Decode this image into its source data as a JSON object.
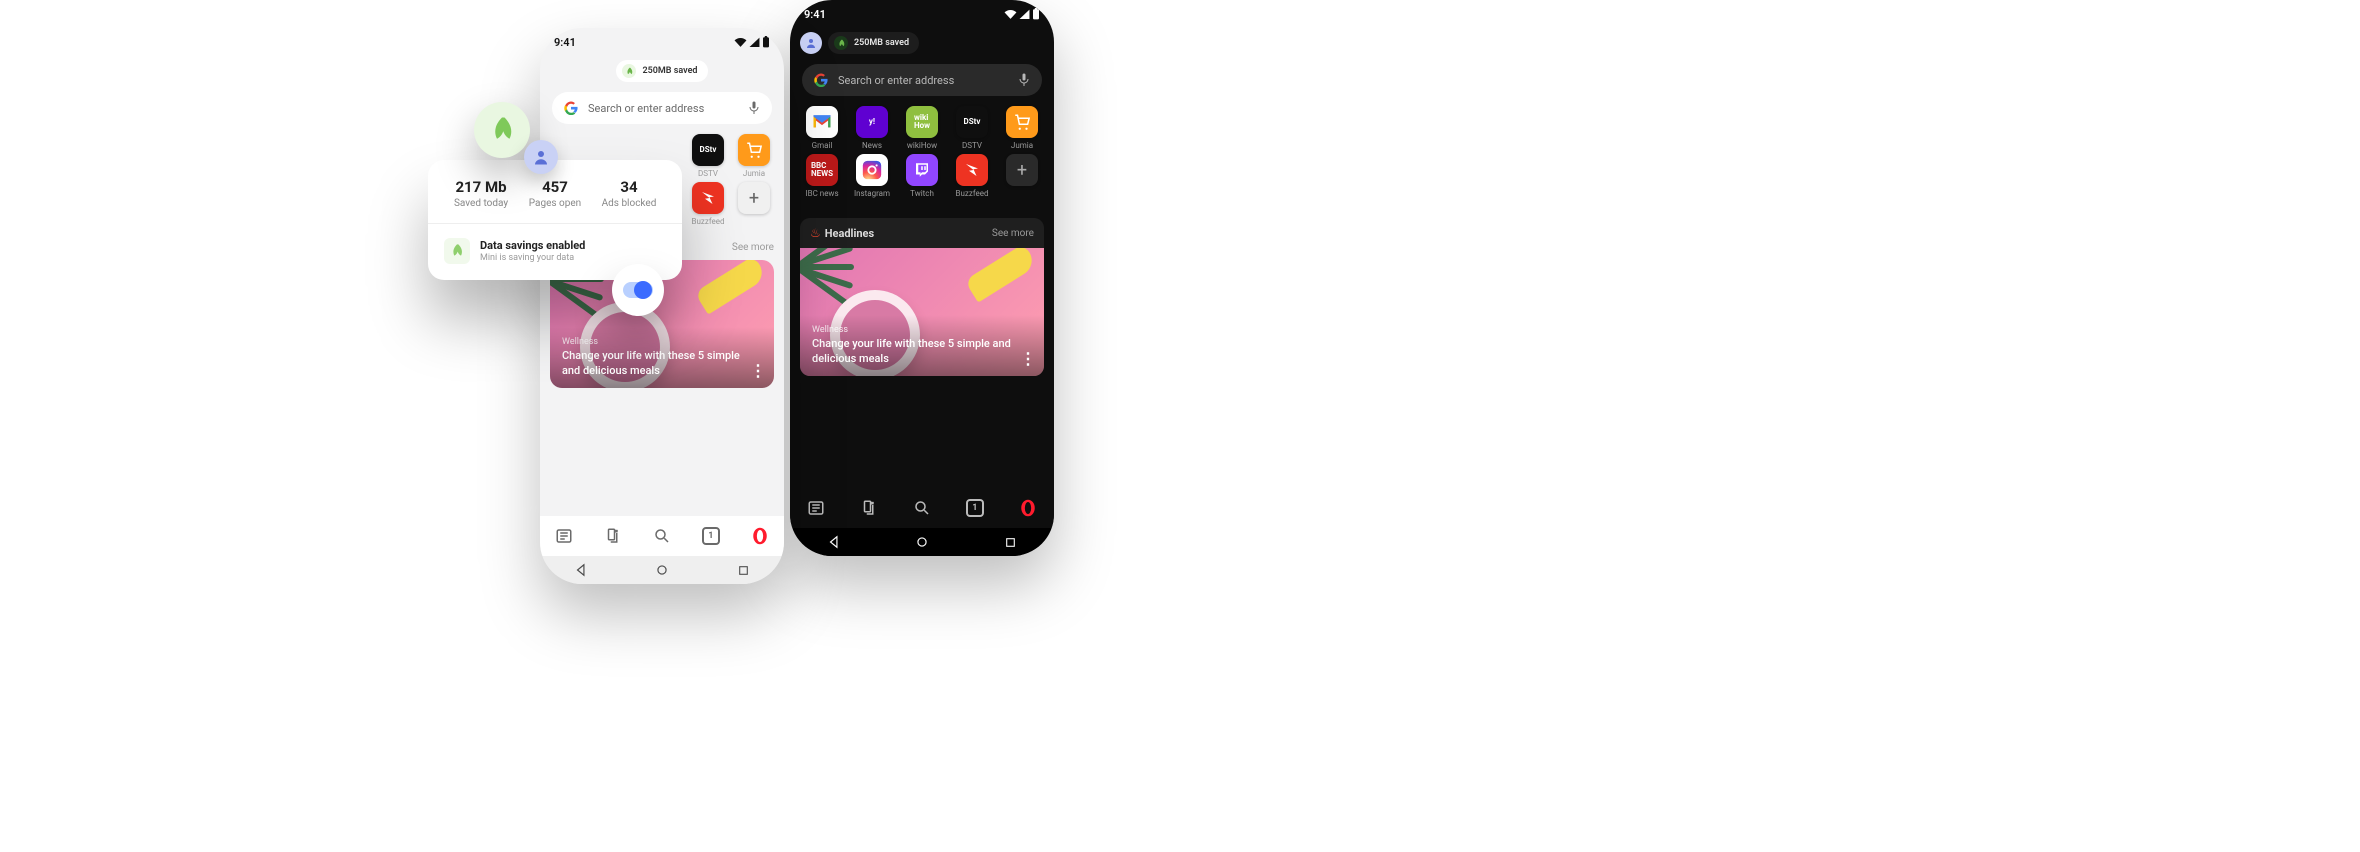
{
  "status": {
    "time": "9:41"
  },
  "saved_pill": {
    "label": "250MB saved"
  },
  "popover": {
    "stats": [
      {
        "value": "217 Mb",
        "label": "Saved today"
      },
      {
        "value": "457",
        "label": "Pages open"
      },
      {
        "value": "34",
        "label": "Ads blocked"
      }
    ],
    "toggle_title": "Data savings enabled",
    "toggle_sub": "Mini is saving your data"
  },
  "search": {
    "placeholder": "Search or enter address"
  },
  "light": {
    "tiles": [
      {
        "label": "DSTV",
        "bg": "#0f0f0f",
        "text": "DStv",
        "fg": "#fff"
      },
      {
        "label": "Jumia",
        "bg": "#ff9a1a",
        "text": "",
        "fg": "#fff",
        "cart": true
      },
      {
        "label": "Buzzfeed",
        "bg": "#ee3322",
        "text": "",
        "fg": "#fff",
        "buzz": true
      }
    ],
    "toolbar": {
      "tab_count": "1"
    }
  },
  "dark": {
    "tiles": [
      {
        "label": "Gmail",
        "bg": "#ffffff",
        "gmail": true
      },
      {
        "label": "News",
        "bg": "#5f01d1",
        "text": "y!",
        "fg": "#fff"
      },
      {
        "label": "wikiHow",
        "bg": "#8fbf3f",
        "text": "wiki\nHow",
        "fg": "#fff"
      },
      {
        "label": "DSTV",
        "bg": "#0f0f0f",
        "text": "DStv",
        "fg": "#fff"
      },
      {
        "label": "Jumia",
        "bg": "#ff9a1a",
        "cart": true,
        "fg": "#fff"
      },
      {
        "label": "IBC news",
        "bg": "#bb1919",
        "text": "BBC\nNEWS",
        "fg": "#fff"
      },
      {
        "label": "Instagram",
        "bg": "#ffffff",
        "insta": true
      },
      {
        "label": "Twitch",
        "bg": "#9146ff",
        "twitch": true,
        "fg": "#fff"
      },
      {
        "label": "Buzzfeed",
        "bg": "#ee3322",
        "buzz": true,
        "fg": "#fff"
      }
    ],
    "toolbar": {
      "tab_count": "1"
    }
  },
  "headlines": {
    "title": "Headlines",
    "see_more": "See more",
    "article_category": "Wellness",
    "article_title": "Change your life with these 5 simple and delicious meals"
  }
}
